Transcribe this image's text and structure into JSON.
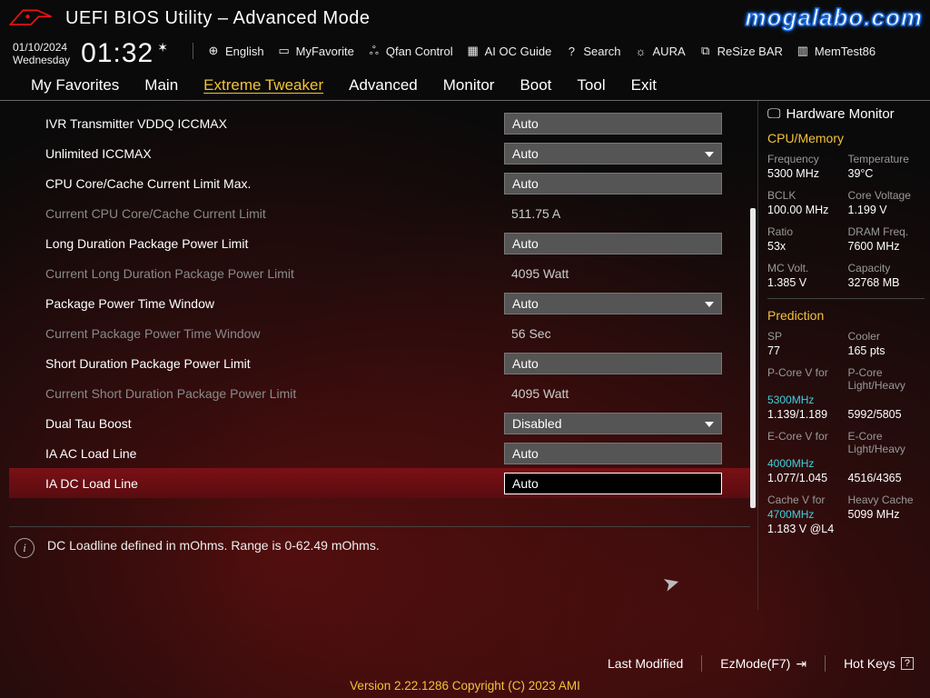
{
  "watermark": "mogalabo.com",
  "header": {
    "title": "UEFI BIOS Utility – Advanced Mode",
    "date": "01/10/2024",
    "day": "Wednesday",
    "time": "01:32",
    "items": {
      "language": "English",
      "favorite": "MyFavorite",
      "qfan": "Qfan Control",
      "aioc": "AI OC Guide",
      "search": "Search",
      "aura": "AURA",
      "resize": "ReSize BAR",
      "memtest": "MemTest86"
    }
  },
  "tabs": [
    "My Favorites",
    "Main",
    "Extreme Tweaker",
    "Advanced",
    "Monitor",
    "Boot",
    "Tool",
    "Exit"
  ],
  "activeTab": "Extreme Tweaker",
  "rows": [
    {
      "label": "IVR Transmitter VDDQ ICCMAX",
      "type": "text",
      "value": "Auto"
    },
    {
      "label": "Unlimited ICCMAX",
      "type": "dropdown",
      "value": "Auto"
    },
    {
      "label": "CPU Core/Cache Current Limit Max.",
      "type": "text",
      "value": "Auto"
    },
    {
      "label": "Current CPU Core/Cache Current Limit",
      "type": "static",
      "value": "511.75 A"
    },
    {
      "label": "Long Duration Package Power Limit",
      "type": "text",
      "value": "Auto"
    },
    {
      "label": "Current Long Duration Package Power Limit",
      "type": "static",
      "value": "4095 Watt"
    },
    {
      "label": "Package Power Time Window",
      "type": "dropdown",
      "value": "Auto"
    },
    {
      "label": "Current Package Power Time Window",
      "type": "static",
      "value": "56 Sec"
    },
    {
      "label": "Short Duration Package Power Limit",
      "type": "text",
      "value": "Auto"
    },
    {
      "label": "Current Short Duration Package Power Limit",
      "type": "static",
      "value": "4095 Watt"
    },
    {
      "label": "Dual Tau Boost",
      "type": "dropdown",
      "value": "Disabled"
    },
    {
      "label": "IA AC Load Line",
      "type": "text",
      "value": "Auto"
    },
    {
      "label": "IA DC Load Line",
      "type": "text",
      "value": "Auto",
      "selected": true
    }
  ],
  "help": "DC Loadline defined in mOhms. Range is 0-62.49 mOhms.",
  "sidebar": {
    "title": "Hardware Monitor",
    "cpumem": {
      "heading": "CPU/Memory",
      "freq_l": "Frequency",
      "freq_v": "5300 MHz",
      "temp_l": "Temperature",
      "temp_v": "39°C",
      "bclk_l": "BCLK",
      "bclk_v": "100.00 MHz",
      "cvolt_l": "Core Voltage",
      "cvolt_v": "1.199 V",
      "ratio_l": "Ratio",
      "ratio_v": "53x",
      "dram_l": "DRAM Freq.",
      "dram_v": "7600 MHz",
      "mc_l": "MC Volt.",
      "mc_v": "1.385 V",
      "cap_l": "Capacity",
      "cap_v": "32768 MB"
    },
    "pred": {
      "heading": "Prediction",
      "sp_l": "SP",
      "sp_v": "77",
      "cool_l": "Cooler",
      "cool_v": "165 pts",
      "pcv_l": "P-Core V for",
      "pcv_f": "5300MHz",
      "pcv_v": "1.139/1.189",
      "pcl_l": "P-Core Light/Heavy",
      "pcl_v": "5992/5805",
      "ecv_l": "E-Core V for",
      "ecv_f": "4000MHz",
      "ecv_v": "1.077/1.045",
      "ecl_l": "E-Core Light/Heavy",
      "ecl_v": "4516/4365",
      "ccv_l": "Cache V for",
      "ccv_f": "4700MHz",
      "ccv_v": "1.183 V @L4",
      "ccl_l": "Heavy Cache",
      "ccl_v": "5099 MHz"
    }
  },
  "footer": {
    "lastmod": "Last Modified",
    "ezmode": "EzMode(F7)",
    "hotkeys": "Hot Keys",
    "copyright": "Version 2.22.1286 Copyright (C) 2023 AMI"
  }
}
